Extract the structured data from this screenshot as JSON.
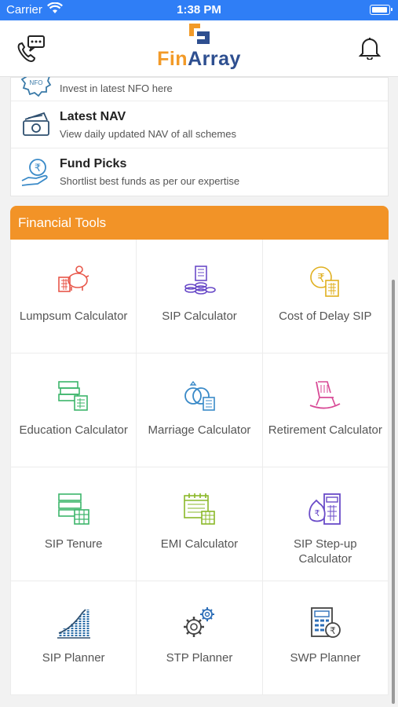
{
  "status_bar": {
    "carrier": "Carrier",
    "time": "1:38 PM"
  },
  "header": {
    "logo_fin": "Fin",
    "logo_array": "Array",
    "icons": {
      "left": "support-chat-phone-icon",
      "right": "bell-icon"
    }
  },
  "menu": {
    "items": [
      {
        "title": "",
        "desc": "Invest in latest NFO here",
        "icon": "nfo-icon"
      },
      {
        "title": "Latest NAV",
        "desc": "View daily updated NAV of all schemes",
        "icon": "banknotes-icon"
      },
      {
        "title": "Fund Picks",
        "desc": "Shortlist best funds as per our expertise",
        "icon": "rupee-hand-icon"
      }
    ]
  },
  "tools": {
    "header": "Financial Tools",
    "items": [
      {
        "label": "Lumpsum Calculator",
        "icon": "piggy-bank-calculator-icon"
      },
      {
        "label": "SIP Calculator",
        "icon": "coins-calculator-icon"
      },
      {
        "label": "Cost of Delay SIP",
        "icon": "rupee-coin-calculator-icon"
      },
      {
        "label": "Education Calculator",
        "icon": "books-calculator-icon"
      },
      {
        "label": "Marriage Calculator",
        "icon": "rings-calculator-icon"
      },
      {
        "label": "Retirement Calculator",
        "icon": "rocking-chair-icon"
      },
      {
        "label": "SIP Tenure",
        "icon": "stack-calculator-icon"
      },
      {
        "label": "EMI Calculator",
        "icon": "calendar-calculator-icon"
      },
      {
        "label": "SIP Step-up Calculator",
        "icon": "money-bag-calculator-icon"
      },
      {
        "label": "SIP Planner",
        "icon": "growth-bars-icon"
      },
      {
        "label": "STP Planner",
        "icon": "gears-icon"
      },
      {
        "label": "SWP Planner",
        "icon": "calculator-rupee-icon"
      }
    ]
  },
  "colors": {
    "status_bar": "#2f7ef6",
    "accent_orange": "#f29327",
    "brand_blue": "#2e4f90"
  }
}
